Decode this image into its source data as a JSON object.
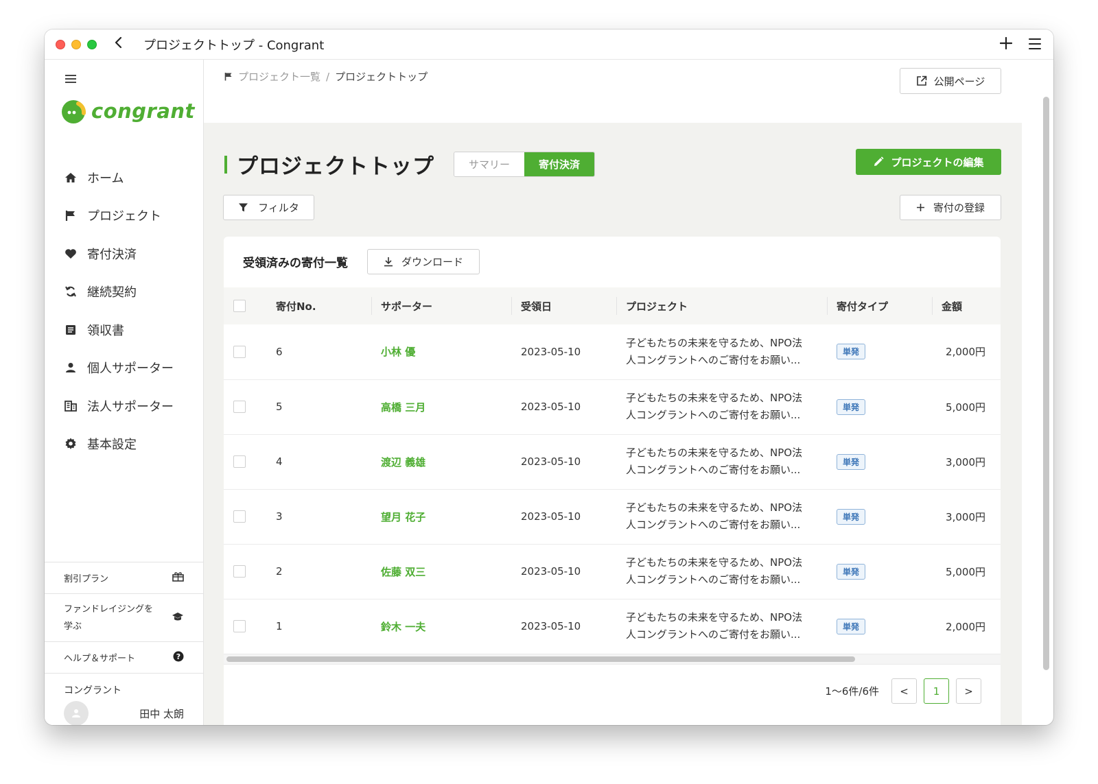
{
  "window": {
    "title": "プロジェクトトップ - Congrant"
  },
  "sidebar": {
    "logo_text": "congrant",
    "items": [
      {
        "label": "ホーム",
        "icon": "home-icon"
      },
      {
        "label": "プロジェクト",
        "icon": "flag-icon"
      },
      {
        "label": "寄付決済",
        "icon": "heart-icon"
      },
      {
        "label": "継続契約",
        "icon": "refresh-icon"
      },
      {
        "label": "領収書",
        "icon": "receipt-icon"
      },
      {
        "label": "個人サポーター",
        "icon": "person-icon"
      },
      {
        "label": "法人サポーター",
        "icon": "building-icon"
      },
      {
        "label": "基本設定",
        "icon": "gear-icon"
      }
    ],
    "bottom_links": {
      "discount_plan": "割引プラン",
      "learn_line1": "ファンドレイジングを",
      "learn_line2": "学ぶ",
      "help": "ヘルプ＆サポート"
    },
    "user": {
      "org": "コングラント",
      "name": "田中 太朗"
    }
  },
  "header": {
    "breadcrumb_parent": "プロジェクト一覧",
    "breadcrumb_sep": "/",
    "breadcrumb_current": "プロジェクトトップ",
    "public_page_label": "公開ページ"
  },
  "page": {
    "title": "プロジェクトトップ",
    "tabs": [
      {
        "label": "サマリー",
        "active": false
      },
      {
        "label": "寄付決済",
        "active": true
      }
    ],
    "edit_button": "プロジェクトの編集",
    "filter_button": "フィルタ",
    "register_button": "寄付の登録"
  },
  "donations": {
    "title": "受領済みの寄付一覧",
    "download_button": "ダウンロード",
    "columns": [
      "寄付No.",
      "サポーター",
      "受領日",
      "プロジェクト",
      "寄付タイプ",
      "金額"
    ],
    "rows": [
      {
        "no": "6",
        "supporter": "小林 優",
        "date": "2023-05-10",
        "project_line1": "子どもたちの未来を守るため、NPO法",
        "project_line2": "人コングラントへのご寄付をお願い...",
        "type": "単発",
        "amount": "2,000円"
      },
      {
        "no": "5",
        "supporter": "高橋 三月",
        "date": "2023-05-10",
        "project_line1": "子どもたちの未来を守るため、NPO法",
        "project_line2": "人コングラントへのご寄付をお願い...",
        "type": "単発",
        "amount": "5,000円"
      },
      {
        "no": "4",
        "supporter": "渡辺 義雄",
        "date": "2023-05-10",
        "project_line1": "子どもたちの未来を守るため、NPO法",
        "project_line2": "人コングラントへのご寄付をお願い...",
        "type": "単発",
        "amount": "3,000円"
      },
      {
        "no": "3",
        "supporter": "望月 花子",
        "date": "2023-05-10",
        "project_line1": "子どもたちの未来を守るため、NPO法",
        "project_line2": "人コングラントへのご寄付をお願い...",
        "type": "単発",
        "amount": "3,000円"
      },
      {
        "no": "2",
        "supporter": "佐藤 双三",
        "date": "2023-05-10",
        "project_line1": "子どもたちの未来を守るため、NPO法",
        "project_line2": "人コングラントへのご寄付をお願い...",
        "type": "単発",
        "amount": "5,000円"
      },
      {
        "no": "1",
        "supporter": "鈴木 一夫",
        "date": "2023-05-10",
        "project_line1": "子どもたちの未来を守るため、NPO法",
        "project_line2": "人コングラントへのご寄付をお願い...",
        "type": "単発",
        "amount": "2,000円"
      }
    ],
    "pagination": {
      "info": "1〜6件/6件",
      "prev": "<",
      "current": "1",
      "next": ">"
    }
  },
  "colors": {
    "brand_green": "#4fae33",
    "badge_blue": "#3d76b8",
    "background": "#f2f2ef"
  }
}
